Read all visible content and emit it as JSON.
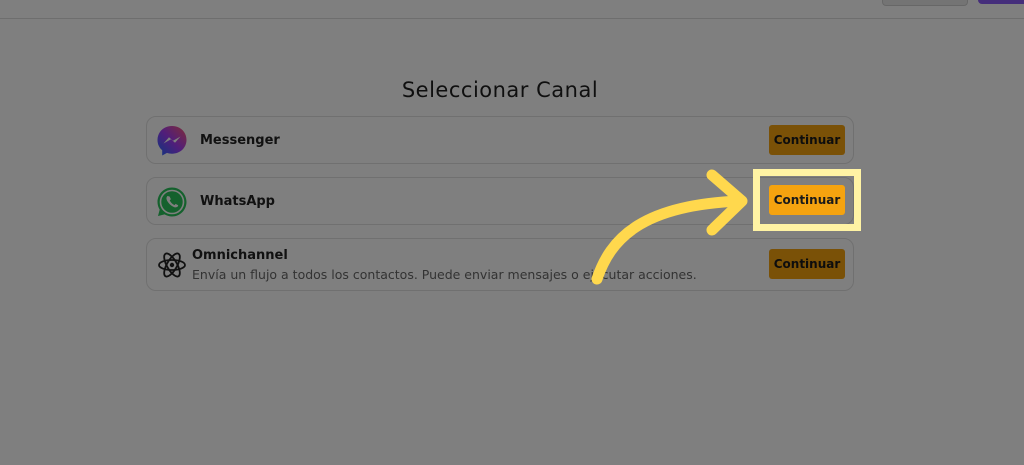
{
  "page": {
    "title": "Seleccionar Canal"
  },
  "channels": [
    {
      "name": "Messenger",
      "description": "",
      "icon": "messenger-icon",
      "button_label": "Continuar"
    },
    {
      "name": "WhatsApp",
      "description": "",
      "icon": "whatsapp-icon",
      "button_label": "Continuar"
    },
    {
      "name": "Omnichannel",
      "description": "Envía un flujo a todos los contactos. Puede enviar mensajes o ejecutar acciones.",
      "icon": "atom-icon",
      "button_label": "Continuar"
    }
  ],
  "colors": {
    "accent": "#f5a30f",
    "highlight": "#fff3a4",
    "arrow": "#ffd84d",
    "overlay": "rgba(0,0,0,0.5)"
  }
}
